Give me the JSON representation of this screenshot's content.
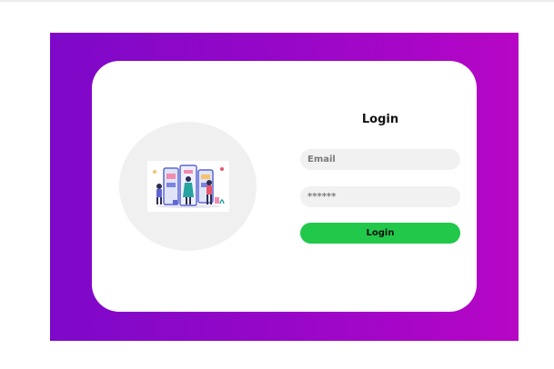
{
  "login": {
    "title": "Login",
    "email_placeholder": "Email",
    "password_placeholder": "******",
    "button_label": "Login"
  },
  "colors": {
    "gradient_start": "#7e08c9",
    "gradient_end": "#b706c6",
    "button": "#21c84a",
    "input_bg": "#f1f1f1"
  },
  "illustration": {
    "icon": "shopping-app-illustration"
  }
}
